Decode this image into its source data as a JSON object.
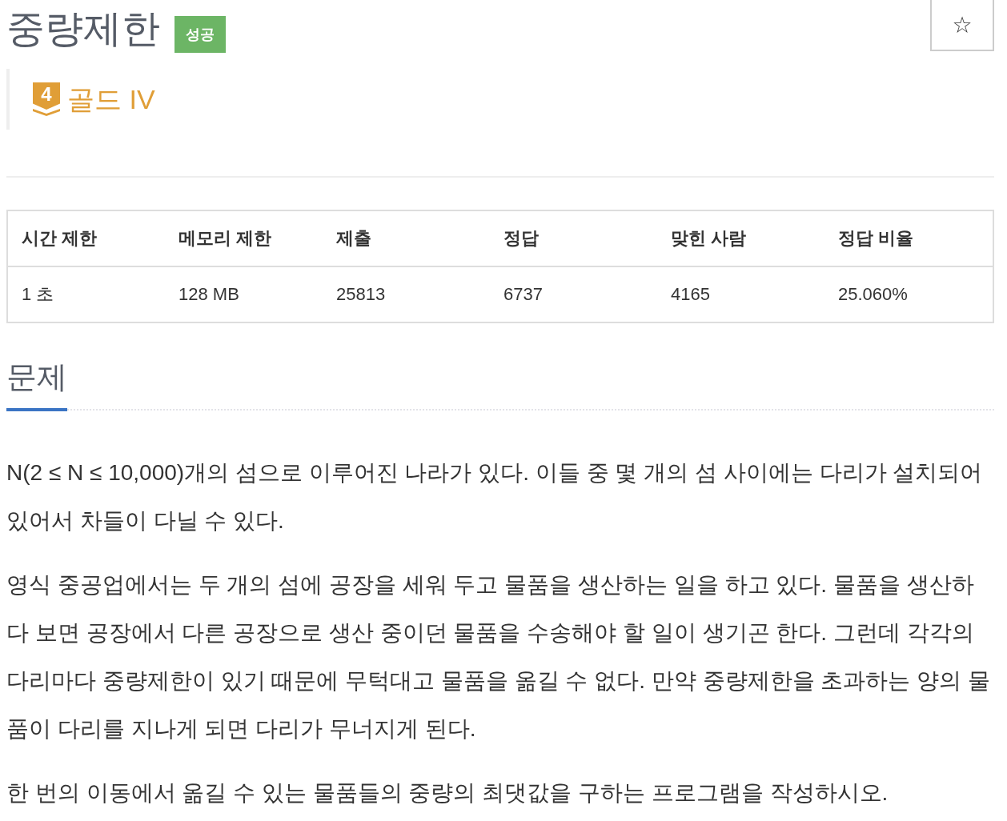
{
  "problem": {
    "title": "중량제한",
    "result_badge": "성공",
    "favorite_button": {
      "label": "☆"
    }
  },
  "tier": {
    "number": "4",
    "name": "골드 IV"
  },
  "stats_table": {
    "columns": [
      "시간 제한",
      "메모리 제한",
      "제출",
      "정답",
      "맞힌 사람",
      "정답 비율"
    ],
    "rows": [
      [
        "1 초",
        "128 MB",
        "25813",
        "6737",
        "4165",
        "25.060%"
      ]
    ]
  },
  "section": {
    "title": "문제",
    "paragraphs": [
      "N(2 ≤ N ≤ 10,000)개의 섬으로 이루어진 나라가 있다. 이들 중 몇 개의 섬 사이에는 다리가 설치되어 있어서 차들이 다닐 수 있다.",
      "영식 중공업에서는 두 개의 섬에 공장을 세워 두고 물품을 생산하는 일을 하고 있다. 물품을 생산하다 보면 공장에서 다른 공장으로 생산 중이던 물품을 수송해야 할 일이 생기곤 한다. 그런데 각각의 다리마다 중량제한이 있기 때문에 무턱대고 물품을 옮길 수 없다. 만약 중량제한을 초과하는 양의 물품이 다리를 지나게 되면 다리가 무너지게 된다.",
      "한 번의 이동에서 옮길 수 있는 물품들의 중량의 최댓값을 구하는 프로그램을 작성하시오."
    ]
  }
}
